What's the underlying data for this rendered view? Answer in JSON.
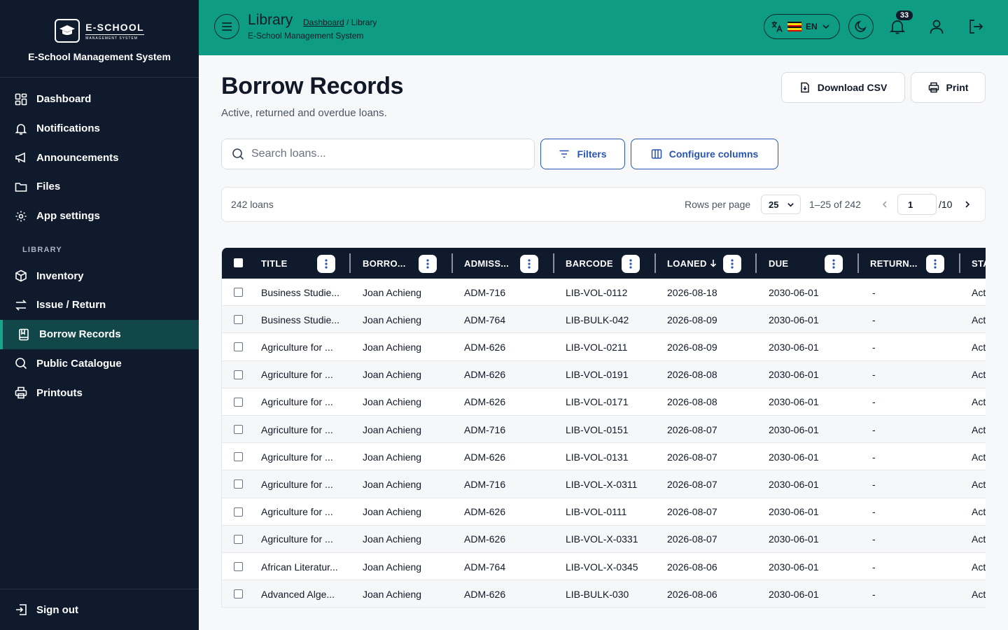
{
  "brand": {
    "logo_name": "E-SCHOOL",
    "logo_tagline": "MANAGEMENT SYSTEM",
    "title": "E-School Management System"
  },
  "sidebar": {
    "items": [
      {
        "label": "Dashboard",
        "icon": "dashboard-icon"
      },
      {
        "label": "Notifications",
        "icon": "bell-icon"
      },
      {
        "label": "Announcements",
        "icon": "megaphone-icon"
      },
      {
        "label": "Files",
        "icon": "folder-icon"
      },
      {
        "label": "App settings",
        "icon": "gear-icon"
      }
    ],
    "section_label": "LIBRARY",
    "library_items": [
      {
        "label": "Inventory",
        "icon": "box-icon"
      },
      {
        "label": "Issue / Return",
        "icon": "swap-icon"
      },
      {
        "label": "Borrow Records",
        "icon": "book-icon",
        "active": true
      },
      {
        "label": "Public Catalogue",
        "icon": "search-icon"
      },
      {
        "label": "Printouts",
        "icon": "printer-icon"
      }
    ],
    "sign_out": "Sign out"
  },
  "header": {
    "title": "Library",
    "breadcrumb_link": "Dashboard",
    "breadcrumb_sep": " / ",
    "breadcrumb_current": "Library",
    "subtitle": "E-School Management System",
    "language": "EN",
    "notification_count": "33",
    "colors": {
      "bar": "#0e9c85",
      "sidebar": "#0f1b2d",
      "accent": "#2954b3"
    }
  },
  "page": {
    "title": "Borrow Records",
    "subtitle": "Active, returned and overdue loans.",
    "download_csv": "Download CSV",
    "print": "Print",
    "search_placeholder": "Search loans...",
    "filters": "Filters",
    "configure_columns": "Configure columns"
  },
  "pager": {
    "count": "242 loans",
    "rows_per_page_label": "Rows per page",
    "rows_per_page": "25",
    "range": "1–25 of 242",
    "current_page": "1",
    "total_pages": "/10"
  },
  "table": {
    "columns": [
      "TITLE",
      "BORRO...",
      "ADMISS...",
      "BARCODE",
      "LOANED",
      "DUE",
      "RETURN...",
      "STA"
    ],
    "sort_column": "LOANED",
    "rows": [
      [
        "Business Studie...",
        "Joan Achieng",
        "ADM-716",
        "LIB-VOL-0112",
        "2026-08-18",
        "2030-06-01",
        "-",
        "Act"
      ],
      [
        "Business Studie...",
        "Joan Achieng",
        "ADM-764",
        "LIB-BULK-042",
        "2026-08-09",
        "2030-06-01",
        "-",
        "Act"
      ],
      [
        "Agriculture for ...",
        "Joan Achieng",
        "ADM-626",
        "LIB-VOL-0211",
        "2026-08-09",
        "2030-06-01",
        "-",
        "Act"
      ],
      [
        "Agriculture for ...",
        "Joan Achieng",
        "ADM-626",
        "LIB-VOL-0191",
        "2026-08-08",
        "2030-06-01",
        "-",
        "Act"
      ],
      [
        "Agriculture for ...",
        "Joan Achieng",
        "ADM-626",
        "LIB-VOL-0171",
        "2026-08-08",
        "2030-06-01",
        "-",
        "Act"
      ],
      [
        "Agriculture for ...",
        "Joan Achieng",
        "ADM-716",
        "LIB-VOL-0151",
        "2026-08-07",
        "2030-06-01",
        "-",
        "Act"
      ],
      [
        "Agriculture for ...",
        "Joan Achieng",
        "ADM-626",
        "LIB-VOL-0131",
        "2026-08-07",
        "2030-06-01",
        "-",
        "Act"
      ],
      [
        "Agriculture for ...",
        "Joan Achieng",
        "ADM-716",
        "LIB-VOL-X-0311",
        "2026-08-07",
        "2030-06-01",
        "-",
        "Act"
      ],
      [
        "Agriculture for ...",
        "Joan Achieng",
        "ADM-626",
        "LIB-VOL-0111",
        "2026-08-07",
        "2030-06-01",
        "-",
        "Act"
      ],
      [
        "Agriculture for ...",
        "Joan Achieng",
        "ADM-626",
        "LIB-VOL-X-0331",
        "2026-08-07",
        "2030-06-01",
        "-",
        "Act"
      ],
      [
        "African Literatur...",
        "Joan Achieng",
        "ADM-764",
        "LIB-VOL-X-0345",
        "2026-08-06",
        "2030-06-01",
        "-",
        "Act"
      ],
      [
        "Advanced Alge...",
        "Joan Achieng",
        "ADM-626",
        "LIB-BULK-030",
        "2026-08-06",
        "2030-06-01",
        "-",
        "Act"
      ]
    ]
  }
}
